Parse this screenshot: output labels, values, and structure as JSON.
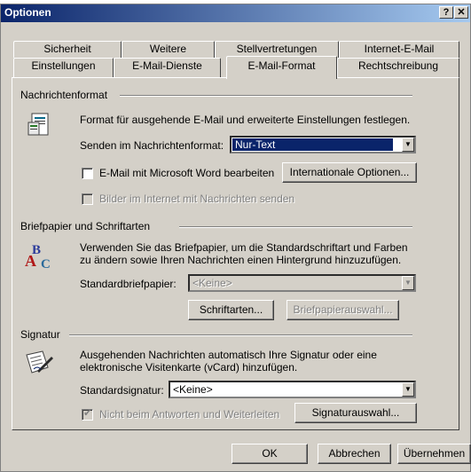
{
  "window": {
    "title": "Optionen",
    "help_btn": "?",
    "close_btn": "✕"
  },
  "tabs_top": [
    "Sicherheit",
    "Weitere",
    "Stellvertretungen",
    "Internet-E-Mail"
  ],
  "tabs_bottom": [
    "Einstellungen",
    "E-Mail-Dienste",
    "E-Mail-Format",
    "Rechtschreibung"
  ],
  "active_tab": "E-Mail-Format",
  "nachrichtenformat": {
    "heading": "Nachrichtenformat",
    "description": "Format für ausgehende E-Mail und erweiterte Einstellungen festlegen.",
    "format_label": "Senden im Nachrichtenformat:",
    "format_value": "Nur-Text",
    "word_checkbox_label": "E-Mail mit Microsoft Word bearbeiten",
    "word_checked": false,
    "international_button": "Internationale Optionen...",
    "images_checkbox_label": "Bilder im Internet mit Nachrichten senden",
    "images_checked": false
  },
  "briefpapier": {
    "heading": "Briefpapier und Schriftarten",
    "description_line1": "Verwenden Sie das Briefpapier, um die Standardschriftart und Farben",
    "description_line2": "zu ändern sowie Ihren Nachrichten einen Hintergrund hinzuzufügen.",
    "stationery_label": "Standardbriefpapier:",
    "stationery_value": "<Keine>",
    "fonts_button": "Schriftarten...",
    "stationery_button": "Briefpapierauswahl..."
  },
  "signatur": {
    "heading": "Signatur",
    "description_line1": "Ausgehenden Nachrichten automatisch Ihre Signatur oder eine",
    "description_line2": "elektronische Visitenkarte (vCard) hinzufügen.",
    "signature_label": "Standardsignatur:",
    "signature_value": "<Keine>",
    "no_reply_checkbox_label": "Nicht beim Antworten und Weiterleiten",
    "no_reply_checked": true,
    "signature_button": "Signaturauswahl..."
  },
  "footer": {
    "ok": "OK",
    "cancel": "Abbrechen",
    "apply": "Übernehmen"
  },
  "colors": {
    "titlebar_start": "#0a246a",
    "titlebar_end": "#a6caf0",
    "face": "#d4d0c8",
    "selection": "#0a246a"
  }
}
